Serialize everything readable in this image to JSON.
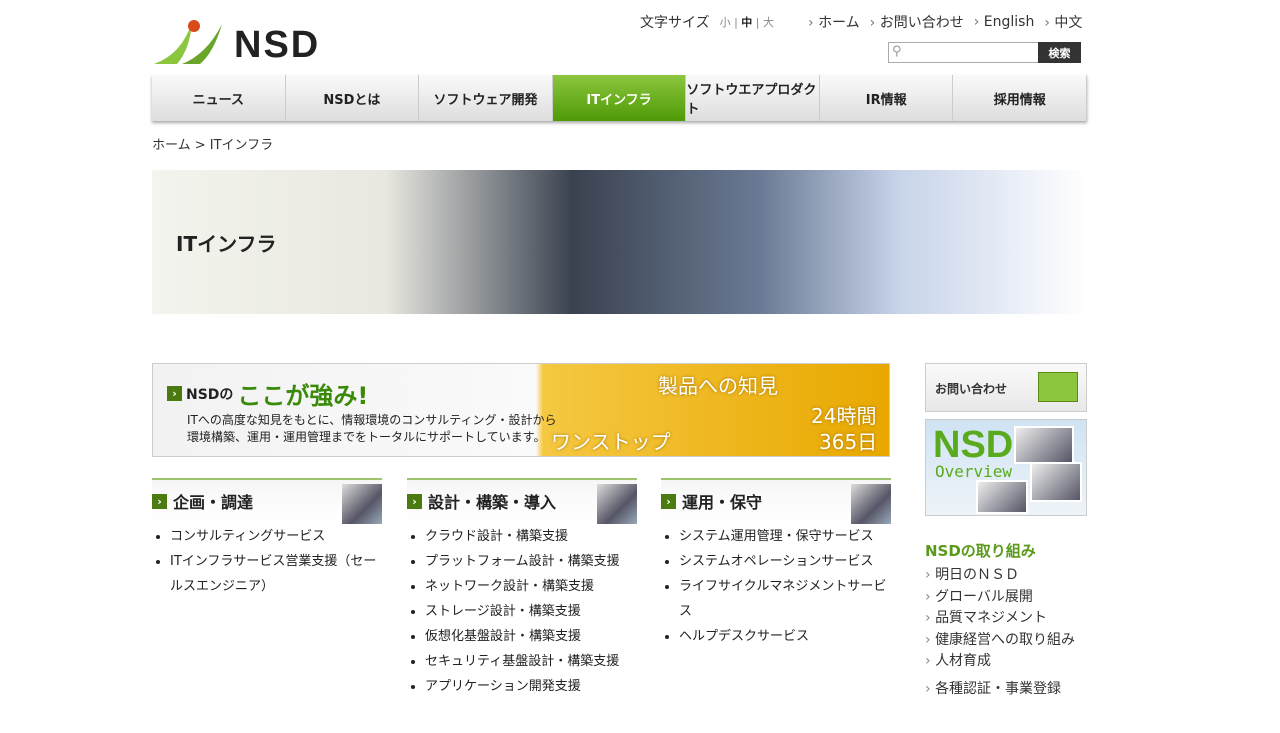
{
  "header": {
    "logo_text": "NSD",
    "font_size_label": "文字サイズ",
    "font_sizes": [
      "小",
      "中",
      "大"
    ],
    "links": [
      "ホーム",
      "お問い合わせ",
      "English",
      "中文"
    ],
    "search": {
      "placeholder": "",
      "button": "検索"
    }
  },
  "nav": [
    "ニュース",
    "NSDとは",
    "ソフトウェア開発",
    "ITインフラ",
    "ソフトウエアプロダクト",
    "IR情報",
    "採用情報"
  ],
  "nav_active": "ITインフラ",
  "breadcrumb": "ホーム > ITインフラ",
  "hero": {
    "title": "ITインフラ"
  },
  "banner": {
    "prefix": "NSDの",
    "headline": "ここが強み!",
    "desc1": "ITへの高度な知見をもとに、情報環境のコンサルティング・設計から",
    "desc2": "環境構築、運用・運用管理までをトータルにサポートしています。",
    "phrases": [
      "ワンストップ",
      "製品への知見",
      "24時間",
      "365日"
    ]
  },
  "columns": [
    {
      "title": "企画・調達",
      "items": [
        "コンサルティングサービス",
        "ITインフラサービス営業支援（セールスエンジニア）"
      ]
    },
    {
      "title": "設計・構築・導入",
      "items": [
        "クラウド設計・構築支援",
        "プラットフォーム設計・構築支援",
        "ネットワーク設計・構築支援",
        "ストレージ設計・構築支援",
        "仮想化基盤設計・構築支援",
        "セキュリティ基盤設計・構築支援",
        "アプリケーション開発支援"
      ]
    },
    {
      "title": "運用・保守",
      "items": [
        "システム運用管理・保守サービス",
        "システムオペレーションサービス",
        "ライフサイクルマネジメントサービス",
        "ヘルプデスクサービス"
      ]
    }
  ],
  "sidebar": {
    "contact": "お問い合わせ",
    "overview_title": "NSD",
    "overview_sub": "Overview",
    "section_title": "NSDの取り組み",
    "links": [
      "明日のＮＳＤ",
      "グローバル展開",
      "品質マネジメント",
      "健康経営への取り組み",
      "人材育成",
      "各種認証・事業登録"
    ]
  },
  "colors": {
    "accent": "#5a9a1a",
    "nav_active": "#6aaa1e"
  }
}
